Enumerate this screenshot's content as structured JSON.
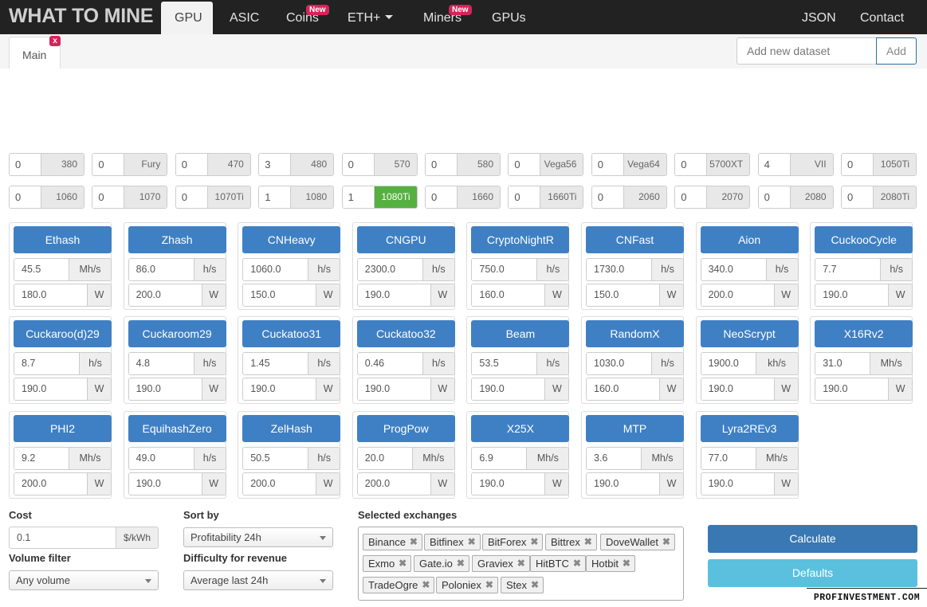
{
  "brand": "WHAT TO MINE",
  "nav": {
    "gpu": "GPU",
    "asic": "ASIC",
    "coins": "Coins",
    "coins_badge": "New",
    "eth": "ETH+",
    "miners": "Miners",
    "miners_badge": "New",
    "gpus": "GPUs",
    "json": "JSON",
    "contact": "Contact"
  },
  "tabs": {
    "main": "Main",
    "close": "x"
  },
  "dataset": {
    "placeholder": "Add new dataset",
    "add": "Add"
  },
  "gpu_row1": [
    {
      "count": "0",
      "label": "380"
    },
    {
      "count": "0",
      "label": "Fury"
    },
    {
      "count": "0",
      "label": "470"
    },
    {
      "count": "3",
      "label": "480"
    },
    {
      "count": "0",
      "label": "570"
    },
    {
      "count": "0",
      "label": "580"
    },
    {
      "count": "0",
      "label": "Vega56"
    },
    {
      "count": "0",
      "label": "Vega64"
    },
    {
      "count": "0",
      "label": "5700XT"
    },
    {
      "count": "4",
      "label": "VII"
    },
    {
      "count": "0",
      "label": "1050Ti"
    }
  ],
  "gpu_row2": [
    {
      "count": "0",
      "label": "1060"
    },
    {
      "count": "0",
      "label": "1070"
    },
    {
      "count": "0",
      "label": "1070Ti"
    },
    {
      "count": "1",
      "label": "1080"
    },
    {
      "count": "1",
      "label": "1080Ti",
      "active": true
    },
    {
      "count": "0",
      "label": "1660"
    },
    {
      "count": "0",
      "label": "1660Ti"
    },
    {
      "count": "0",
      "label": "2060"
    },
    {
      "count": "0",
      "label": "2070"
    },
    {
      "count": "0",
      "label": "2080"
    },
    {
      "count": "0",
      "label": "2080Ti"
    }
  ],
  "algorithms": [
    {
      "name": "Ethash",
      "hashrate": "45.5",
      "hash_unit": "Mh/s",
      "power": "180.0",
      "power_unit": "W"
    },
    {
      "name": "Zhash",
      "hashrate": "86.0",
      "hash_unit": "h/s",
      "power": "200.0",
      "power_unit": "W"
    },
    {
      "name": "CNHeavy",
      "hashrate": "1060.0",
      "hash_unit": "h/s",
      "power": "150.0",
      "power_unit": "W"
    },
    {
      "name": "CNGPU",
      "hashrate": "2300.0",
      "hash_unit": "h/s",
      "power": "190.0",
      "power_unit": "W"
    },
    {
      "name": "CryptoNightR",
      "hashrate": "750.0",
      "hash_unit": "h/s",
      "power": "160.0",
      "power_unit": "W"
    },
    {
      "name": "CNFast",
      "hashrate": "1730.0",
      "hash_unit": "h/s",
      "power": "150.0",
      "power_unit": "W"
    },
    {
      "name": "Aion",
      "hashrate": "340.0",
      "hash_unit": "h/s",
      "power": "200.0",
      "power_unit": "W"
    },
    {
      "name": "CuckooCycle",
      "hashrate": "7.7",
      "hash_unit": "h/s",
      "power": "190.0",
      "power_unit": "W"
    },
    {
      "name": "Cuckaroo(d)29",
      "hashrate": "8.7",
      "hash_unit": "h/s",
      "power": "190.0",
      "power_unit": "W"
    },
    {
      "name": "Cuckaroom29",
      "hashrate": "4.8",
      "hash_unit": "h/s",
      "power": "190.0",
      "power_unit": "W"
    },
    {
      "name": "Cuckatoo31",
      "hashrate": "1.45",
      "hash_unit": "h/s",
      "power": "190.0",
      "power_unit": "W"
    },
    {
      "name": "Cuckatoo32",
      "hashrate": "0.46",
      "hash_unit": "h/s",
      "power": "190.0",
      "power_unit": "W"
    },
    {
      "name": "Beam",
      "hashrate": "53.5",
      "hash_unit": "h/s",
      "power": "190.0",
      "power_unit": "W"
    },
    {
      "name": "RandomX",
      "hashrate": "1030.0",
      "hash_unit": "h/s",
      "power": "160.0",
      "power_unit": "W"
    },
    {
      "name": "NeoScrypt",
      "hashrate": "1900.0",
      "hash_unit": "kh/s",
      "power": "190.0",
      "power_unit": "W"
    },
    {
      "name": "X16Rv2",
      "hashrate": "31.0",
      "hash_unit": "Mh/s",
      "power": "190.0",
      "power_unit": "W"
    },
    {
      "name": "PHI2",
      "hashrate": "9.2",
      "hash_unit": "Mh/s",
      "power": "200.0",
      "power_unit": "W"
    },
    {
      "name": "EquihashZero",
      "hashrate": "49.0",
      "hash_unit": "h/s",
      "power": "190.0",
      "power_unit": "W"
    },
    {
      "name": "ZelHash",
      "hashrate": "50.5",
      "hash_unit": "h/s",
      "power": "200.0",
      "power_unit": "W"
    },
    {
      "name": "ProgPow",
      "hashrate": "20.0",
      "hash_unit": "Mh/s",
      "power": "200.0",
      "power_unit": "W"
    },
    {
      "name": "X25X",
      "hashrate": "6.9",
      "hash_unit": "Mh/s",
      "power": "190.0",
      "power_unit": "W"
    },
    {
      "name": "MTP",
      "hashrate": "3.6",
      "hash_unit": "Mh/s",
      "power": "190.0",
      "power_unit": "W"
    },
    {
      "name": "Lyra2REv3",
      "hashrate": "77.0",
      "hash_unit": "Mh/s",
      "power": "190.0",
      "power_unit": "W"
    }
  ],
  "form": {
    "cost_label": "Cost",
    "cost_value": "0.1",
    "cost_unit": "$/kWh",
    "volume_label": "Volume filter",
    "volume_value": "Any volume",
    "sort_label": "Sort by",
    "sort_value": "Profitability 24h",
    "difficulty_label": "Difficulty for revenue",
    "difficulty_value": "Average last 24h",
    "exchanges_label": "Selected exchanges",
    "exchanges": [
      "Binance",
      "Bitfinex",
      "BitForex",
      "Bittrex",
      "DoveWallet",
      "Exmo",
      "Gate.io",
      "Graviex",
      "HitBTC",
      "Hotbit",
      "TradeOgre",
      "Poloniex",
      "Stex"
    ],
    "calculate": "Calculate",
    "defaults": "Defaults"
  },
  "watermark": "PROFINVESTMENT.COM",
  "colors": {
    "topbar": "#222222",
    "primary": "#3f80c4",
    "active_gpu": "#56b040",
    "badge": "#d6235a",
    "info": "#5bc0de"
  }
}
